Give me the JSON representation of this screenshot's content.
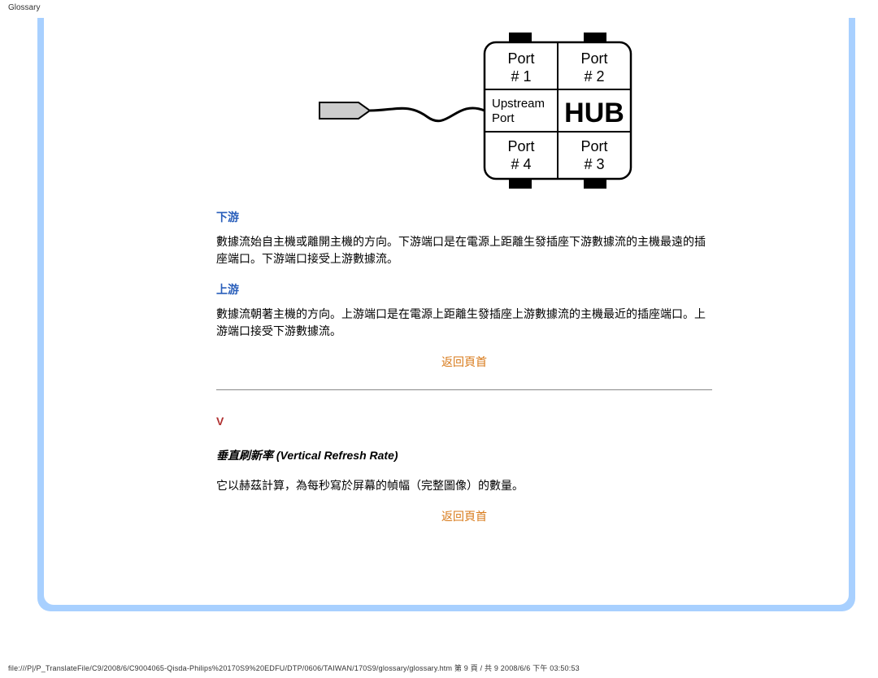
{
  "header": {
    "title": "Glossary"
  },
  "diagram": {
    "port1": "Port\n# 1",
    "port2": "Port\n# 2",
    "port3": "Port\n# 3",
    "port4": "Port\n# 4",
    "upstream_line1": "Upstream",
    "upstream_line2": "Port",
    "hub": "HUB"
  },
  "sections": {
    "downstream": {
      "heading": "下游",
      "body": "數據流始自主機或離開主機的方向。下游端口是在電源上距離生發插座下游數據流的主機最遠的插座端口。下游端口接受上游數據流。"
    },
    "upstream": {
      "heading": "上游",
      "body": "數據流朝著主機的方向。上游端口是在電源上距離生發插座上游數據流的主機最近的插座端口。上游端口接受下游數據流。"
    },
    "return1": "返回頁首",
    "letter": "V",
    "vertical": {
      "heading": "垂直刷新率 (Vertical Refresh Rate)",
      "body": "它以赫茲計算，為每秒寫於屏幕的幀幅（完整圖像）的數量。"
    },
    "return2": "返回頁首"
  },
  "footer": {
    "path": "file:///P|/P_TranslateFile/C9/2008/6/C9004065-Qisda-Philips%20170S9%20EDFU/DTP/0606/TAIWAN/170S9/glossary/glossary.htm 第 9 頁 / 共 9 2008/6/6 下午 03:50:53"
  }
}
